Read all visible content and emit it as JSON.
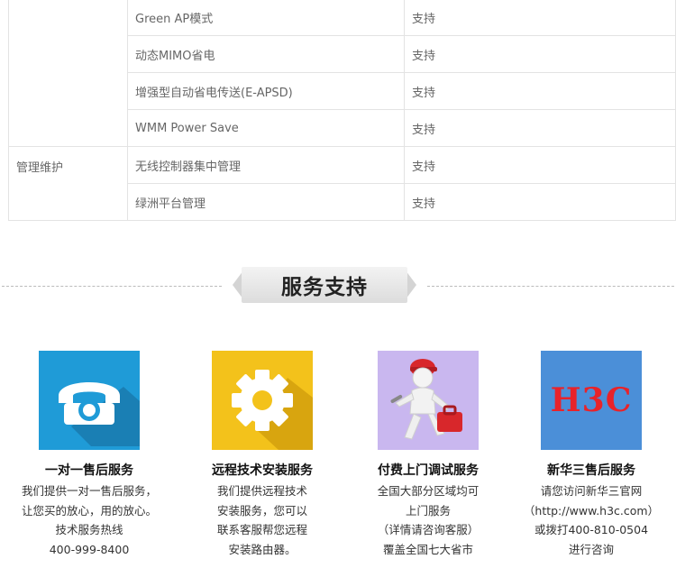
{
  "spec_table": {
    "rows": [
      {
        "category": "",
        "feature": "Green AP模式",
        "value": "支持"
      },
      {
        "category": "",
        "feature": "动态MIMO省电",
        "value": "支持"
      },
      {
        "category": "",
        "feature": "增强型自动省电传送(E-APSD)",
        "value": "支持"
      },
      {
        "category": "",
        "feature": "WMM Power Save",
        "value": "支持"
      },
      {
        "category": "管理维护",
        "feature": "无线控制器集中管理",
        "value": "支持"
      },
      {
        "category": "",
        "feature": "绿洲平台管理",
        "value": "支持"
      }
    ]
  },
  "service_section": {
    "title": "服务支持"
  },
  "services": [
    {
      "icon": "telephone-icon",
      "color": "#1f9bd7",
      "name": "一对一售后服务",
      "lines": [
        "我们提供一对一售后服务，",
        "让您买的放心，用的放心。",
        "技术服务热线",
        "400-999-8400"
      ]
    },
    {
      "icon": "gear-icon",
      "color": "#f3c21b",
      "name": "远程技术安装服务",
      "lines": [
        "我们提供远程技术",
        "安装服务，您可以",
        "联系客服帮您远程",
        "安装路由器。"
      ]
    },
    {
      "icon": "repairman-icon",
      "color": "#c9b7ef",
      "name": "付费上门调试服务",
      "lines": [
        "全国大部分区域均可",
        "上门服务",
        "（详情请咨询客服）",
        "覆盖全国七大省市"
      ]
    },
    {
      "icon": "h3c-logo",
      "color": "#4b8fd8",
      "logo_text": "H3C",
      "name": "新华三售后服务",
      "lines": [
        "请您访问新华三官网",
        "（http://www.h3c.com）",
        "或拨打400-810-0504",
        "进行咨询"
      ]
    }
  ]
}
